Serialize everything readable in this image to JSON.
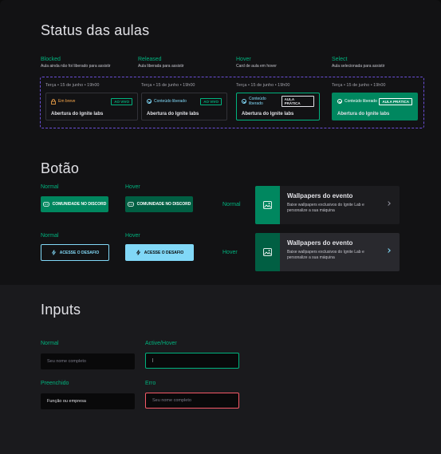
{
  "status_section": {
    "title": "Status das aulas",
    "columns": [
      {
        "head": "Blocked",
        "sub": "Aula ainda não foi liberado para assistir"
      },
      {
        "head": "Released",
        "sub": "Aula liberada para assistir"
      },
      {
        "head": "Hover",
        "sub": "Card de aula em hover"
      },
      {
        "head": "Select",
        "sub": "Aula selecionada para assistir"
      }
    ],
    "cards": [
      {
        "date": "Terça • 15 de junho • 19h00",
        "status": "Em breve",
        "badge": "AO VIVO",
        "title": "Abertura do Ignite labs"
      },
      {
        "date": "Terça • 15 de junho • 19h00",
        "status": "Conteúdo liberado",
        "badge": "AO VIVO",
        "title": "Abertura do Ignite labs"
      },
      {
        "date": "Terça • 15 de junho • 19h00",
        "status": "Conteúdo liberado",
        "badge": "AULA PRÁTICA",
        "title": "Abertura do Ignite labs"
      },
      {
        "date": "Terça • 15 de junho • 19h00",
        "status": "Conteúdo liberado",
        "badge": "AULA PRÁTICA",
        "title": "Abertura do Ignite labs"
      }
    ]
  },
  "button_section": {
    "title": "Botão",
    "normal_label": "Normal",
    "hover_label": "Hover",
    "discord_label": "COMUNIDADE NO DISCORD",
    "desafio_label": "ACESSE O DESAFIO",
    "promo": {
      "title": "Wallpapers do evento",
      "desc": "Baixe wallpapers exclusivos do Ignite Lab e personalize a sua máquina"
    }
  },
  "inputs_section": {
    "title": "Inputs",
    "labels": {
      "normal": "Normal",
      "active": "Active/Hover",
      "filled": "Preenchido",
      "error": "Erro"
    },
    "normal_placeholder": "Seu nome completo",
    "active_value": "|",
    "filled_value": "Função ou empresa",
    "error_placeholder": "Seu nome completo"
  },
  "colors": {
    "green": "#00b37e",
    "green_dark": "#00875f",
    "orange": "#fba94c",
    "blue": "#81d8f7",
    "red": "#f75a68",
    "purple_dash": "#6b4fd8"
  }
}
